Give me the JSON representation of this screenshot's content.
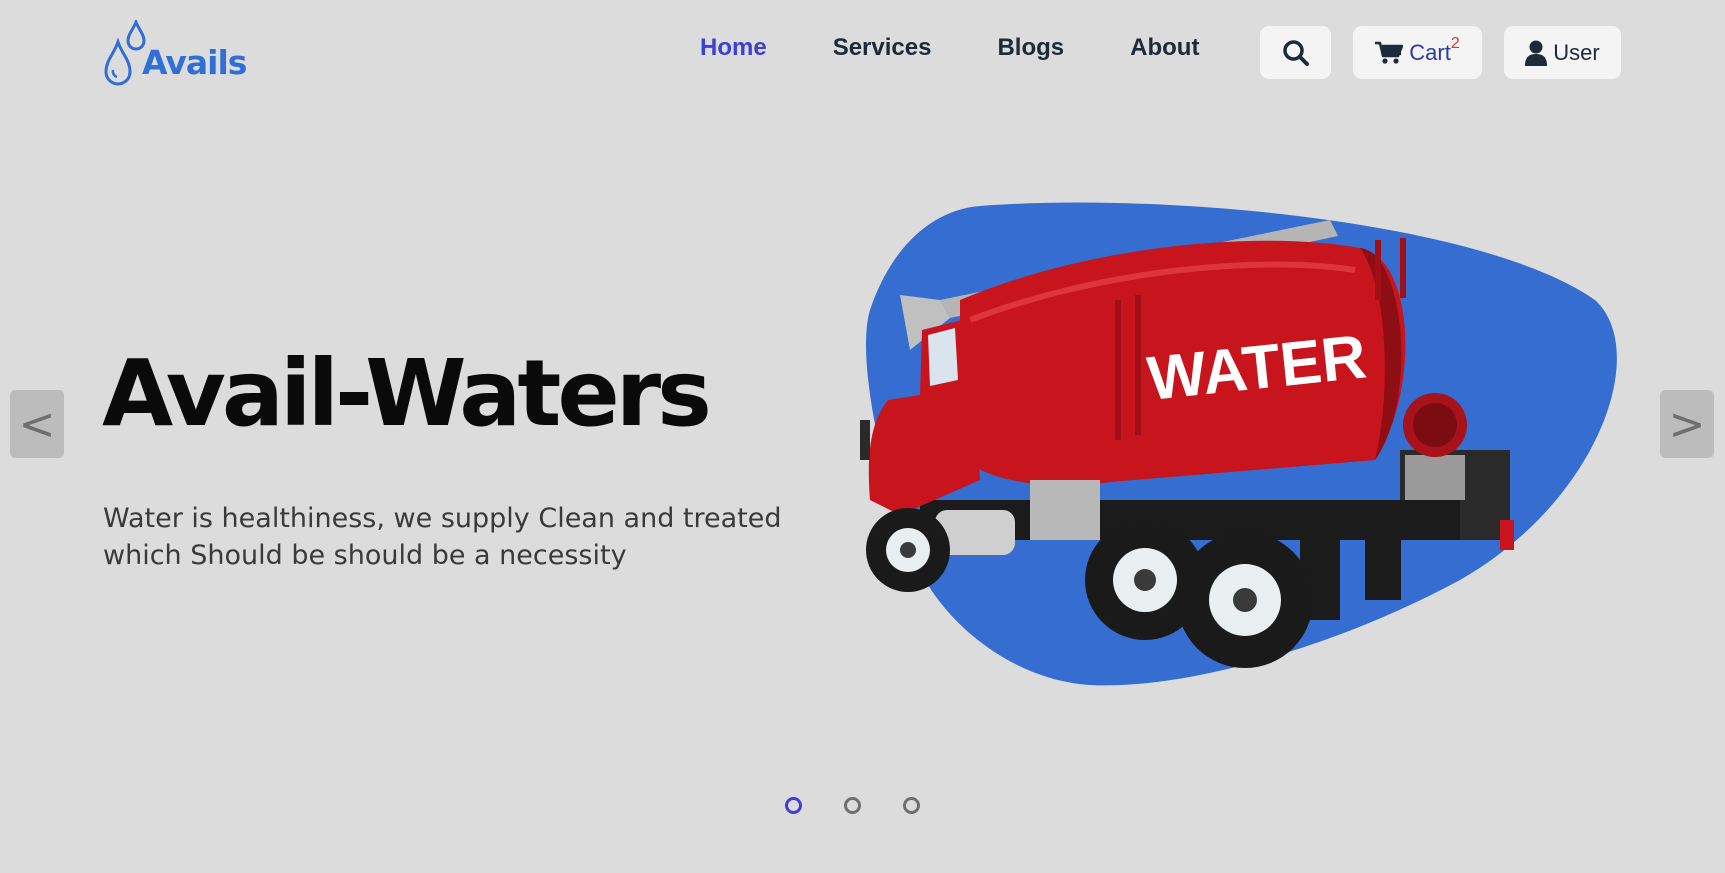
{
  "brand": {
    "name": "Avails",
    "color": "#2f6fd6"
  },
  "nav": {
    "items": [
      {
        "label": "Home",
        "active": true
      },
      {
        "label": "Services",
        "active": false
      },
      {
        "label": "Blogs",
        "active": false
      },
      {
        "label": "About",
        "active": false
      }
    ],
    "active_color": "#3d3fd6"
  },
  "actions": {
    "search_icon": "search-icon",
    "cart": {
      "label": "Cart",
      "count": "2",
      "icon": "cart-icon"
    },
    "user": {
      "label": "User",
      "icon": "user-icon"
    }
  },
  "hero": {
    "title": "Avail-Waters",
    "subtitle": "Water is healthiness, we supply Clean and treated which Should be should be a necessity",
    "image_text": "WATER",
    "blob_color": "#356ed0",
    "truck_color": "#c8141c"
  },
  "carousel": {
    "prev_label": "<",
    "next_label": ">",
    "slide_count": 3,
    "active_index": 0
  }
}
